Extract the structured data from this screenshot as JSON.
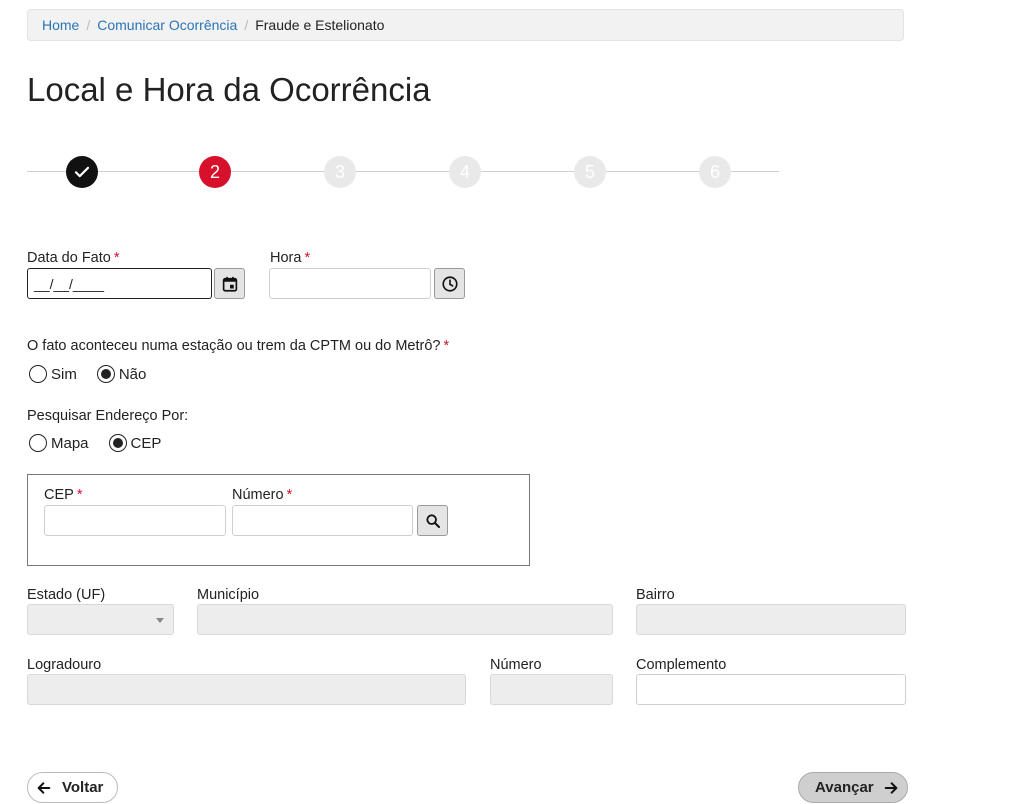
{
  "breadcrumb": {
    "home": "Home",
    "comunicar": "Comunicar Ocorrência",
    "current": "Fraude e Estelionato"
  },
  "page_title": "Local e Hora da Ocorrência",
  "steps": [
    "2",
    "3",
    "4",
    "5",
    "6"
  ],
  "data_fato": {
    "label": "Data do Fato",
    "required": "*",
    "value": "__/__/____"
  },
  "hora": {
    "label": "Hora",
    "required": "*",
    "value": ""
  },
  "cptm": {
    "question": "O fato aconteceu numa estação ou trem da CPTM ou do Metrô?",
    "required": "*",
    "options": [
      "Sim",
      "Não"
    ],
    "selected": "Não"
  },
  "pesquisar": {
    "label": "Pesquisar Endereço Por:",
    "options": [
      "Mapa",
      "CEP"
    ],
    "selected": "CEP"
  },
  "cep_box": {
    "cep_label": "CEP",
    "numero_label": "Número",
    "required": "*",
    "cep_value": "",
    "numero_value": ""
  },
  "address": {
    "estado_label": "Estado (UF)",
    "municipio_label": "Município",
    "bairro_label": "Bairro",
    "logradouro_label": "Logradouro",
    "numero_label": "Número",
    "complemento_label": "Complemento"
  },
  "buttons": {
    "voltar": "Voltar",
    "avancar": "Avançar"
  },
  "colors": {
    "accent": "#d7102b",
    "link": "#2a74b6",
    "done": "#111111"
  }
}
